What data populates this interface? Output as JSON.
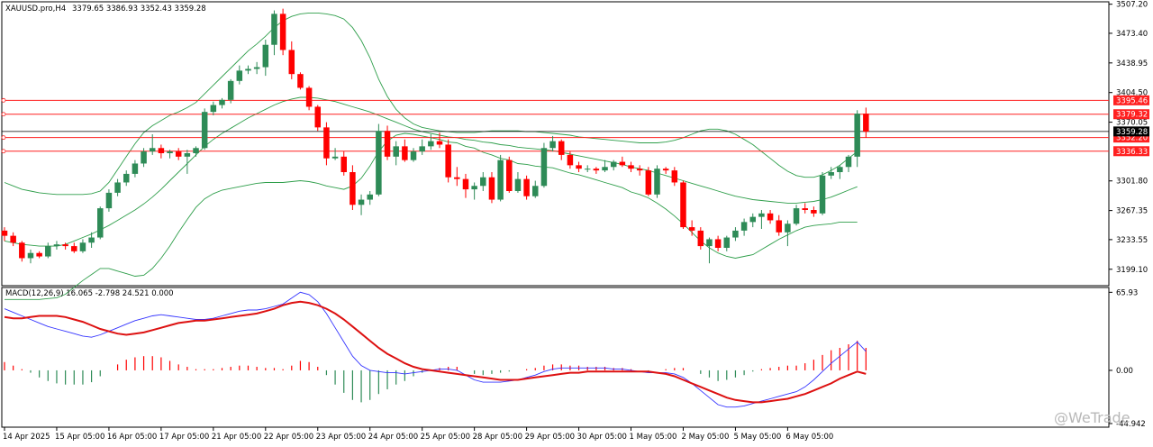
{
  "header": {
    "symbol": "XAUUSD.pro,H4",
    "ohlc": "3379.65 3386.93 3352.43 3359.28"
  },
  "macd_header": {
    "label": "MACD(12,26,9) 16.065 -2.798 24.521 0.000"
  },
  "watermark": {
    "text": "@WeTrade"
  },
  "colors": {
    "bull": "#2e8b57",
    "bear": "#ff0000",
    "bands": "#2e9e4a",
    "macd_line": "#3333ff",
    "signal_line": "#dd1111",
    "level_line": "#ff2020",
    "current_price": "#000000"
  },
  "chart_data": [
    {
      "type": "candlestick",
      "title": "XAUUSD.pro,H4",
      "ylim": [
        3180,
        3510
      ],
      "y_ticks": [
        "3507.20",
        "3473.40",
        "3438.95",
        "3404.50",
        "3370.05",
        "3301.80",
        "3267.35",
        "3233.55",
        "3199.10"
      ],
      "x_ticks": [
        "14 Apr 2025",
        "15 Apr 05:00",
        "16 Apr 05:00",
        "17 Apr 05:00",
        "21 Apr 05:00",
        "22 Apr 05:00",
        "23 Apr 05:00",
        "24 Apr 05:00",
        "25 Apr 05:00",
        "28 Apr 05:00",
        "29 Apr 05:00",
        "30 Apr 05:00",
        "1 May 05:00",
        "2 May 05:00",
        "5 May 05:00",
        "6 May 05:00"
      ],
      "candles": [
        [
          3244,
          3248,
          3232,
          3238
        ],
        [
          3238,
          3242,
          3226,
          3230
        ],
        [
          3230,
          3232,
          3208,
          3212
        ],
        [
          3212,
          3222,
          3206,
          3218
        ],
        [
          3218,
          3220,
          3212,
          3214
        ],
        [
          3214,
          3230,
          3212,
          3226
        ],
        [
          3226,
          3232,
          3222,
          3228
        ],
        [
          3228,
          3230,
          3222,
          3226
        ],
        [
          3226,
          3230,
          3218,
          3220
        ],
        [
          3220,
          3234,
          3218,
          3230
        ],
        [
          3230,
          3242,
          3224,
          3236
        ],
        [
          3236,
          3272,
          3234,
          3270
        ],
        [
          3270,
          3292,
          3266,
          3288
        ],
        [
          3288,
          3304,
          3284,
          3300
        ],
        [
          3300,
          3314,
          3296,
          3310
        ],
        [
          3310,
          3326,
          3306,
          3322
        ],
        [
          3322,
          3340,
          3318,
          3336
        ],
        [
          3336,
          3356,
          3332,
          3340
        ],
        [
          3340,
          3344,
          3328,
          3334
        ],
        [
          3334,
          3338,
          3328,
          3336
        ],
        [
          3336,
          3340,
          3326,
          3330
        ],
        [
          3330,
          3338,
          3310,
          3334
        ],
        [
          3334,
          3342,
          3330,
          3340
        ],
        [
          3340,
          3386,
          3338,
          3382
        ],
        [
          3382,
          3394,
          3378,
          3390
        ],
        [
          3390,
          3398,
          3386,
          3396
        ],
        [
          3396,
          3420,
          3392,
          3418
        ],
        [
          3418,
          3436,
          3414,
          3430
        ],
        [
          3430,
          3436,
          3426,
          3432
        ],
        [
          3432,
          3440,
          3426,
          3434
        ],
        [
          3434,
          3466,
          3424,
          3460
        ],
        [
          3460,
          3500,
          3448,
          3496
        ],
        [
          3496,
          3502,
          3448,
          3454
        ],
        [
          3454,
          3464,
          3420,
          3426
        ],
        [
          3426,
          3428,
          3408,
          3410
        ],
        [
          3410,
          3412,
          3384,
          3388
        ],
        [
          3388,
          3390,
          3360,
          3364
        ],
        [
          3364,
          3370,
          3320,
          3328
        ],
        [
          3328,
          3340,
          3326,
          3330
        ],
        [
          3330,
          3336,
          3308,
          3312
        ],
        [
          3312,
          3320,
          3268,
          3274
        ],
        [
          3274,
          3286,
          3262,
          3280
        ],
        [
          3280,
          3290,
          3274,
          3286
        ],
        [
          3286,
          3368,
          3284,
          3360
        ],
        [
          3360,
          3366,
          3326,
          3330
        ],
        [
          3330,
          3348,
          3320,
          3342
        ],
        [
          3342,
          3350,
          3324,
          3326
        ],
        [
          3326,
          3340,
          3324,
          3336
        ],
        [
          3336,
          3350,
          3332,
          3342
        ],
        [
          3342,
          3356,
          3338,
          3348
        ],
        [
          3348,
          3358,
          3340,
          3344
        ],
        [
          3344,
          3350,
          3300,
          3306
        ],
        [
          3306,
          3318,
          3296,
          3304
        ],
        [
          3304,
          3310,
          3282,
          3292
        ],
        [
          3292,
          3300,
          3280,
          3296
        ],
        [
          3296,
          3312,
          3290,
          3306
        ],
        [
          3306,
          3312,
          3276,
          3280
        ],
        [
          3280,
          3332,
          3278,
          3326
        ],
        [
          3326,
          3330,
          3288,
          3290
        ],
        [
          3290,
          3312,
          3288,
          3304
        ],
        [
          3304,
          3308,
          3280,
          3284
        ],
        [
          3284,
          3302,
          3282,
          3296
        ],
        [
          3296,
          3346,
          3294,
          3340
        ],
        [
          3340,
          3354,
          3336,
          3348
        ],
        [
          3348,
          3350,
          3326,
          3332
        ],
        [
          3332,
          3336,
          3316,
          3320
        ],
        [
          3320,
          3324,
          3312,
          3316
        ],
        [
          3316,
          3320,
          3312,
          3316
        ],
        [
          3316,
          3318,
          3310,
          3314
        ],
        [
          3314,
          3326,
          3312,
          3318
        ],
        [
          3318,
          3326,
          3314,
          3324
        ],
        [
          3324,
          3330,
          3318,
          3320
        ],
        [
          3320,
          3324,
          3312,
          3316
        ],
        [
          3316,
          3320,
          3308,
          3314
        ],
        [
          3314,
          3318,
          3284,
          3286
        ],
        [
          3286,
          3320,
          3282,
          3316
        ],
        [
          3316,
          3318,
          3310,
          3314
        ],
        [
          3314,
          3318,
          3296,
          3300
        ],
        [
          3300,
          3302,
          3246,
          3248
        ],
        [
          3248,
          3256,
          3238,
          3244
        ],
        [
          3244,
          3248,
          3222,
          3226
        ],
        [
          3226,
          3236,
          3206,
          3234
        ],
        [
          3234,
          3238,
          3220,
          3224
        ],
        [
          3224,
          3238,
          3220,
          3236
        ],
        [
          3236,
          3248,
          3232,
          3244
        ],
        [
          3244,
          3258,
          3238,
          3254
        ],
        [
          3254,
          3264,
          3248,
          3260
        ],
        [
          3260,
          3268,
          3246,
          3264
        ],
        [
          3264,
          3268,
          3252,
          3256
        ],
        [
          3256,
          3262,
          3238,
          3242
        ],
        [
          3242,
          3256,
          3226,
          3252
        ],
        [
          3252,
          3274,
          3250,
          3270
        ],
        [
          3270,
          3276,
          3264,
          3268
        ],
        [
          3268,
          3272,
          3260,
          3264
        ],
        [
          3264,
          3312,
          3262,
          3308
        ],
        [
          3308,
          3318,
          3304,
          3312
        ],
        [
          3312,
          3320,
          3304,
          3318
        ],
        [
          3318,
          3332,
          3312,
          3330
        ],
        [
          3330,
          3384,
          3318,
          3380
        ],
        [
          3380,
          3387,
          3352,
          3359
        ]
      ],
      "bands_upper": [
        3300,
        3296,
        3292,
        3290,
        3288,
        3287,
        3286,
        3286,
        3286,
        3286,
        3287,
        3290,
        3300,
        3315,
        3330,
        3345,
        3358,
        3366,
        3372,
        3378,
        3382,
        3387,
        3393,
        3403,
        3413,
        3423,
        3433,
        3443,
        3453,
        3461,
        3470,
        3480,
        3488,
        3493,
        3496,
        3497,
        3497,
        3496,
        3494,
        3490,
        3480,
        3465,
        3445,
        3420,
        3400,
        3385,
        3375,
        3368,
        3364,
        3362,
        3360,
        3359,
        3358,
        3358,
        3358,
        3359,
        3360,
        3360,
        3360,
        3360,
        3359,
        3359,
        3358,
        3357,
        3356,
        3355,
        3353,
        3352,
        3351,
        3350,
        3349,
        3348,
        3347,
        3346,
        3346,
        3346,
        3347,
        3349,
        3352,
        3356,
        3360,
        3362,
        3362,
        3360,
        3356,
        3350,
        3344,
        3336,
        3328,
        3320,
        3313,
        3308,
        3306,
        3306,
        3309,
        3314,
        3320,
        3328,
        3336
      ],
      "bands_middle": [
        3232,
        3230,
        3228,
        3227,
        3226,
        3226,
        3226,
        3228,
        3232,
        3236,
        3240,
        3245,
        3250,
        3256,
        3262,
        3268,
        3275,
        3283,
        3292,
        3302,
        3312,
        3322,
        3332,
        3342,
        3350,
        3357,
        3363,
        3369,
        3375,
        3380,
        3385,
        3390,
        3394,
        3397,
        3399,
        3399,
        3398,
        3396,
        3394,
        3391,
        3388,
        3385,
        3382,
        3378,
        3374,
        3370,
        3366,
        3362,
        3359,
        3357,
        3355,
        3353,
        3352,
        3350,
        3349,
        3347,
        3346,
        3344,
        3343,
        3341,
        3340,
        3339,
        3338,
        3337,
        3335,
        3333,
        3331,
        3329,
        3327,
        3325,
        3323,
        3321,
        3318,
        3316,
        3314,
        3311,
        3308,
        3305,
        3302,
        3299,
        3296,
        3293,
        3290,
        3287,
        3284,
        3282,
        3280,
        3279,
        3278,
        3277,
        3276,
        3276,
        3277,
        3278,
        3280,
        3283,
        3287,
        3291,
        3295
      ],
      "bands_lower": [
        3164,
        3164,
        3164,
        3164,
        3164,
        3165,
        3166,
        3170,
        3178,
        3186,
        3193,
        3200,
        3200,
        3197,
        3194,
        3191,
        3192,
        3200,
        3212,
        3226,
        3242,
        3257,
        3271,
        3281,
        3287,
        3291,
        3293,
        3295,
        3297,
        3299,
        3300,
        3300,
        3300,
        3301,
        3302,
        3301,
        3299,
        3296,
        3294,
        3292,
        3296,
        3305,
        3319,
        3336,
        3348,
        3355,
        3357,
        3356,
        3354,
        3352,
        3350,
        3347,
        3346,
        3342,
        3340,
        3335,
        3332,
        3328,
        3326,
        3322,
        3321,
        3319,
        3318,
        3317,
        3314,
        3311,
        3309,
        3306,
        3303,
        3300,
        3297,
        3294,
        3289,
        3286,
        3282,
        3276,
        3269,
        3261,
        3252,
        3242,
        3232,
        3224,
        3218,
        3214,
        3212,
        3214,
        3216,
        3222,
        3228,
        3234,
        3239,
        3244,
        3248,
        3250,
        3251,
        3252,
        3254,
        3254,
        3254
      ],
      "horizontal_levels": [
        {
          "label": "3395.46",
          "value": 3395.46
        },
        {
          "label": "3379.32",
          "value": 3379.32
        },
        {
          "label": "3352.20",
          "value": 3352.2
        },
        {
          "label": "3336.33",
          "value": 3336.33
        }
      ],
      "current_price": {
        "label": "3359.28",
        "value": 3359.28
      }
    },
    {
      "type": "macd",
      "title": "MACD(12,26,9) 16.065 -2.798 24.521 0.000",
      "ylim": [
        -48,
        70
      ],
      "y_ticks": [
        "65.93",
        "0.00",
        "-44.942"
      ],
      "macd_line": [
        52,
        49,
        46,
        43,
        40,
        37,
        35,
        33,
        31,
        29,
        28,
        30,
        33,
        36,
        39,
        42,
        44,
        46,
        47,
        46,
        45,
        44,
        43,
        43,
        44,
        46,
        48,
        50,
        51,
        51,
        52,
        54,
        56,
        61,
        66,
        64,
        58,
        48,
        36,
        24,
        12,
        4,
        0,
        -1,
        -2,
        -2,
        -3,
        -2,
        -1,
        0,
        1,
        1,
        0,
        -4,
        -8,
        -10,
        -10,
        -10,
        -9,
        -8,
        -6,
        -4,
        -1,
        1,
        2,
        2,
        2,
        2,
        2,
        2,
        1,
        1,
        0,
        -1,
        -2,
        -2,
        -2,
        -3,
        -6,
        -11,
        -17,
        -23,
        -29,
        -31,
        -31,
        -30,
        -28,
        -26,
        -24,
        -22,
        -20,
        -18,
        -14,
        -8,
        -1,
        6,
        12,
        18,
        24,
        16
      ],
      "signal_line": [
        45,
        44,
        44,
        45,
        46,
        46,
        46,
        45,
        43,
        41,
        38,
        35,
        33,
        31,
        30,
        31,
        32,
        34,
        36,
        38,
        40,
        41,
        42,
        42,
        43,
        44,
        45,
        46,
        47,
        48,
        50,
        52,
        55,
        57,
        58,
        57,
        55,
        52,
        48,
        43,
        37,
        31,
        25,
        19,
        14,
        10,
        6,
        3,
        1,
        0,
        -1,
        -2,
        -3,
        -4,
        -5,
        -6,
        -7,
        -8,
        -8,
        -8,
        -7,
        -6,
        -5,
        -4,
        -3,
        -2,
        -2,
        -1,
        -1,
        -1,
        -1,
        -1,
        -1,
        -1,
        -1,
        -2,
        -3,
        -5,
        -8,
        -11,
        -14,
        -17,
        -20,
        -23,
        -25,
        -26,
        -27,
        -27,
        -26,
        -25,
        -24,
        -22,
        -20,
        -17,
        -14,
        -11,
        -7,
        -4,
        -1,
        -3
      ],
      "histogram": [
        7,
        4,
        1,
        -2,
        -6,
        -9,
        -11,
        -12,
        -12,
        -12,
        -10,
        -5,
        0,
        5,
        9,
        11,
        12,
        12,
        11,
        8,
        5,
        3,
        1,
        1,
        1,
        2,
        3,
        4,
        4,
        3,
        2,
        2,
        1,
        4,
        8,
        7,
        3,
        -4,
        -12,
        -19,
        -25,
        -27,
        -25,
        -20,
        -16,
        -12,
        -9,
        -5,
        -2,
        0,
        2,
        3,
        3,
        0,
        -3,
        -4,
        -3,
        -2,
        -1,
        0,
        1,
        2,
        4,
        5,
        5,
        4,
        4,
        3,
        3,
        3,
        2,
        2,
        1,
        0,
        -1,
        0,
        1,
        2,
        2,
        0,
        -3,
        -6,
        -9,
        -8,
        -6,
        -4,
        -1,
        1,
        2,
        3,
        4,
        4,
        6,
        9,
        13,
        17,
        19,
        22,
        25,
        19
      ]
    }
  ]
}
